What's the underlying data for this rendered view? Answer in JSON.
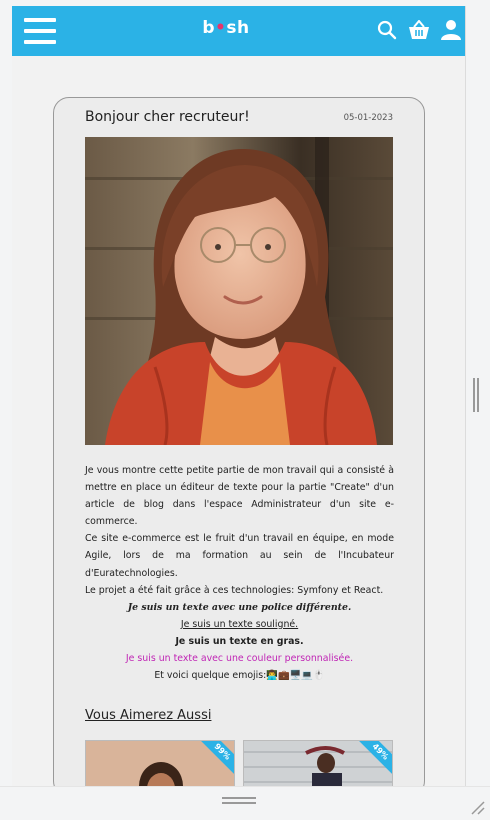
{
  "header": {
    "logo_main": "b",
    "logo_dot": "•",
    "logo_tail": "sh",
    "icons": [
      "menu-icon",
      "search-icon",
      "basket-icon",
      "user-icon"
    ],
    "brand_color": "#2bb2e6"
  },
  "article": {
    "title": "Bonjour cher recruteur!",
    "date": "05-01-2023",
    "p1": "Je vous montre cette petite partie de mon travail qui a consisté à mettre en place un éditeur de texte pour la partie \"Create\" d'un article de blog dans l'espace Administrateur d'un site e-commerce.",
    "p2": "Ce site e-commerce est le fruit d'un travail en équipe, en mode Agile, lors de ma formation au sein de l'Incubateur d'Euratechnologies.",
    "p3": "Le projet a été fait grâce à ces technologies: Symfony et React.",
    "fancy": "Je suis un texte avec une police différente.",
    "underlined": "Je suis un texte souligné.",
    "bold": "Je suis un texte en gras.",
    "colored": "Je suis un texte avec une couleur personnalisée.",
    "emoji_line": "Et voici quelque emojis:👨‍💻💼🖥️💻🖱️"
  },
  "related": {
    "title": "Vous Aimerez Aussi",
    "items": [
      {
        "badge": "99%"
      },
      {
        "badge": "49%"
      }
    ]
  }
}
